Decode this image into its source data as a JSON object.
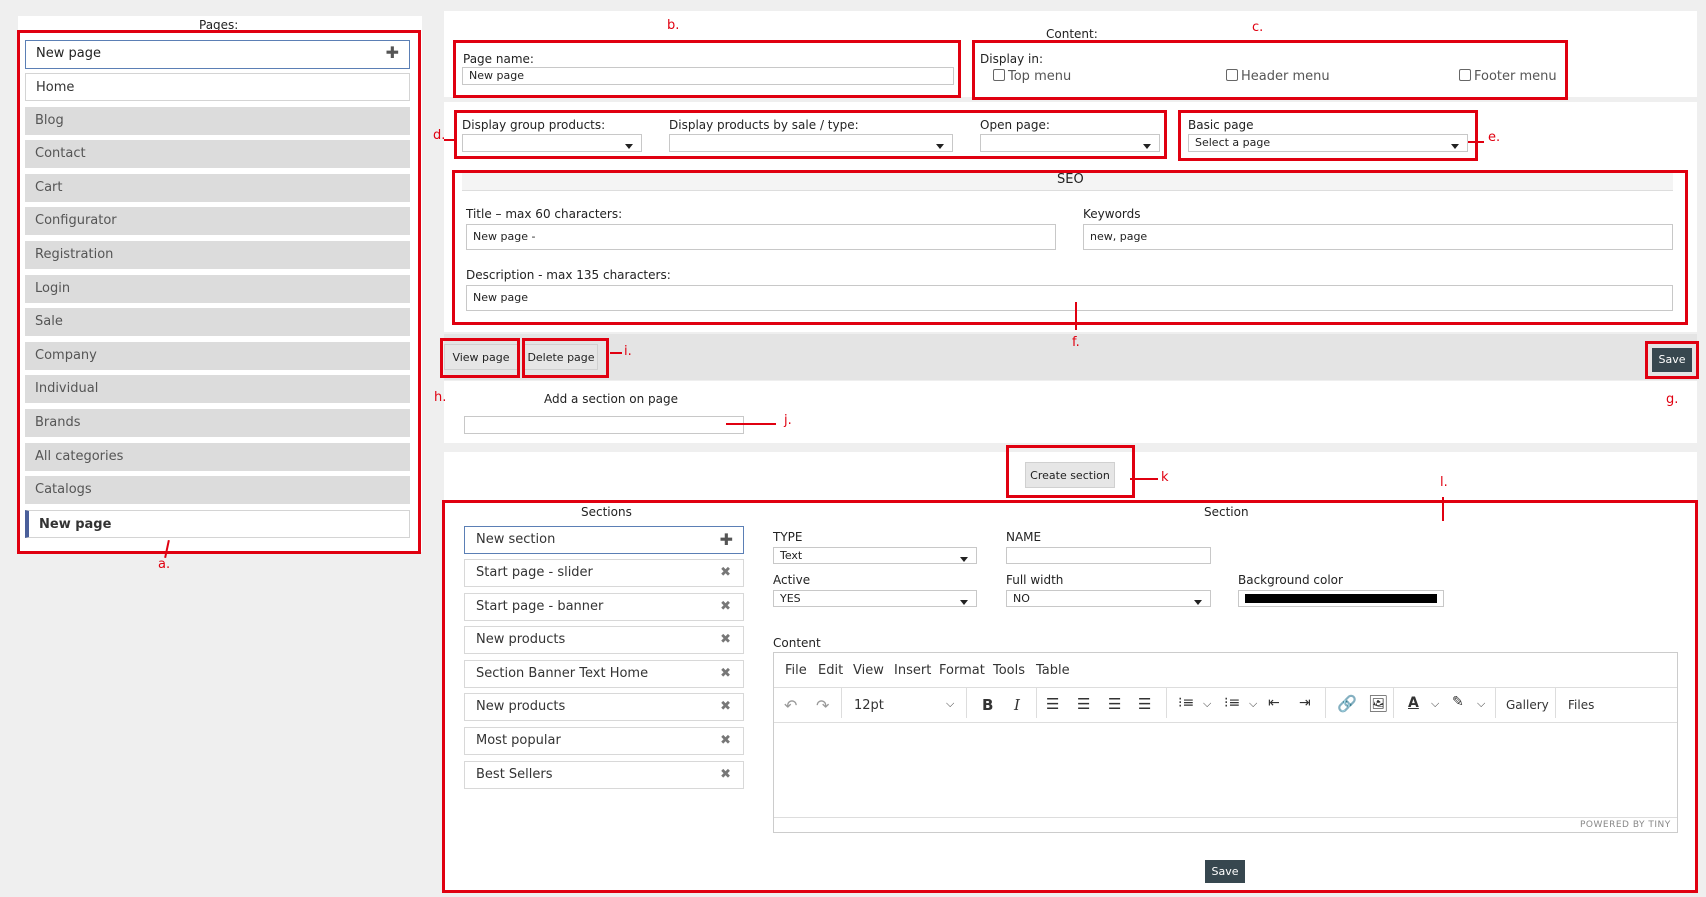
{
  "pages": {
    "heading": "Pages:",
    "new_page": "New page",
    "items": [
      "Home",
      "Blog",
      "Contact",
      "Cart",
      "Configurator",
      "Registration",
      "Login",
      "Sale",
      "Company",
      "Individual",
      "Brands",
      "All categories",
      "Catalogs"
    ],
    "active": "New page"
  },
  "content": {
    "heading": "Content:",
    "page_name_label": "Page name:",
    "page_name_value": "New page",
    "display_in_label": "Display in:",
    "top_menu": "Top menu",
    "header_menu": "Header menu",
    "footer_menu": "Footer menu",
    "display_group_label": "Display group products:",
    "display_sale_label": "Display products by sale / type:",
    "open_page_label": "Open page:",
    "basic_page_label": "Basic page",
    "basic_page_value": "Select a page"
  },
  "seo": {
    "heading": "SEO",
    "title_label": "Title – max 60 characters:",
    "title_value": "New page -",
    "keywords_label": "Keywords",
    "keywords_value": "new, page",
    "description_label": "Description - max 135 characters:",
    "description_value": "New page"
  },
  "actions": {
    "view_page": "View page",
    "delete_page": "Delete page",
    "save": "Save",
    "add_section_label": "Add a section on page",
    "create_section": "Create section"
  },
  "sections": {
    "heading": "Sections",
    "new_section": "New section",
    "items": [
      "Start page - slider",
      "Start page - banner",
      "New products",
      "Section Banner Text Home",
      "New products",
      "Most popular",
      "Best Sellers"
    ]
  },
  "section": {
    "heading": "Section",
    "type_label": "TYPE",
    "type_value": "Text",
    "name_label": "NAME",
    "active_label": "Active",
    "active_value": "YES",
    "full_width_label": "Full width",
    "full_width_value": "NO",
    "bg_color_label": "Background color",
    "bg_color_value": "#000000",
    "content_label": "Content",
    "save": "Save"
  },
  "editor": {
    "menu": [
      "File",
      "Edit",
      "View",
      "Insert",
      "Format",
      "Tools",
      "Table"
    ],
    "font_size": "12pt",
    "gallery": "Gallery",
    "files": "Files",
    "powered": "POWERED BY TINY"
  },
  "annotations": {
    "a": "a.",
    "b": "b.",
    "c": "c.",
    "d": "d.",
    "e": "e.",
    "f": "f.",
    "g": "g.",
    "h": "h.",
    "i": "i.",
    "j": "j.",
    "k": "k",
    "l": "l."
  },
  "colors": {
    "annotation": "#e00010",
    "dark_button": "#37474f",
    "active_accent": "#4a5f9a"
  }
}
